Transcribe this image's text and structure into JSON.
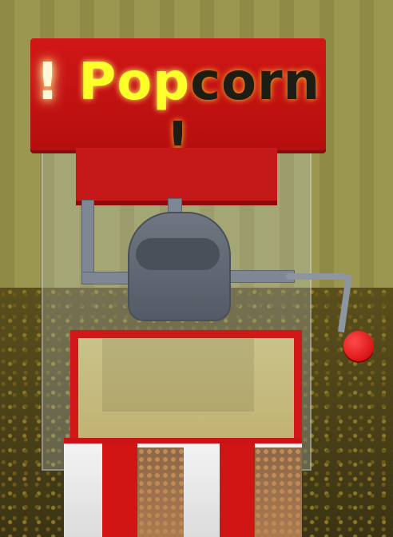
{
  "scene": {
    "sign": {
      "prefix": "!",
      "word_part_1": "Pop",
      "word_part_2": "corn",
      "suffix": "!"
    },
    "colors": {
      "sign_red": "#d11616",
      "glow_yellow": "#ffff2a",
      "glow_white": "#fff7d6",
      "knob_red": "#e10000",
      "pipe_gray": "#7f8795"
    }
  }
}
